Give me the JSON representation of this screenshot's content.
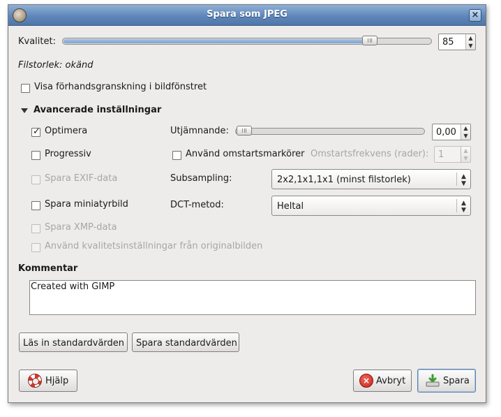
{
  "window": {
    "title": "Spara som JPEG"
  },
  "quality": {
    "label": "Kvalitet:",
    "value": "85",
    "fraction": 0.85
  },
  "filesize": {
    "text": "Filstorlek: okänd"
  },
  "preview": {
    "label": "Visa förhandsgranskning i bildfönstret",
    "checked": false
  },
  "advanced": {
    "label": "Avancerade inställningar"
  },
  "options": {
    "optimize": {
      "label": "Optimera",
      "checked": true
    },
    "progressive": {
      "label": "Progressiv",
      "checked": false
    },
    "exif": {
      "label": "Spara EXIF-data",
      "checked": false,
      "enabled": false
    },
    "thumbnail": {
      "label": "Spara miniatyrbild",
      "checked": false
    },
    "xmp": {
      "label": "Spara XMP-data",
      "checked": false,
      "enabled": false
    },
    "original_quality": {
      "label": "Använd kvalitetsinställningar från originalbilden",
      "checked": false,
      "enabled": false
    }
  },
  "smoothing": {
    "label": "Utjämnande:",
    "value": "0,00",
    "fraction": 0.0
  },
  "restart": {
    "label": "Använd omstartsmarkörer",
    "checked": false,
    "freq_label": "Omstartsfrekvens (rader):",
    "freq_value": "1"
  },
  "subsampling": {
    "label": "Subsampling:",
    "value": "2x2,1x1,1x1 (minst filstorlek)"
  },
  "dct": {
    "label": "DCT-metod:",
    "value": "Heltal"
  },
  "comment": {
    "label": "Kommentar",
    "value": "Created with GIMP"
  },
  "buttons": {
    "load_defaults": "Läs in standardvärden",
    "save_defaults": "Spara standardvärden",
    "help": "Hjälp",
    "cancel": "Avbryt",
    "save": "Spara"
  },
  "icons": {
    "help": "lifebuoy-icon",
    "cancel": "cancel-icon",
    "save": "save-icon",
    "app": "gimp-icon",
    "close": "close-icon"
  }
}
